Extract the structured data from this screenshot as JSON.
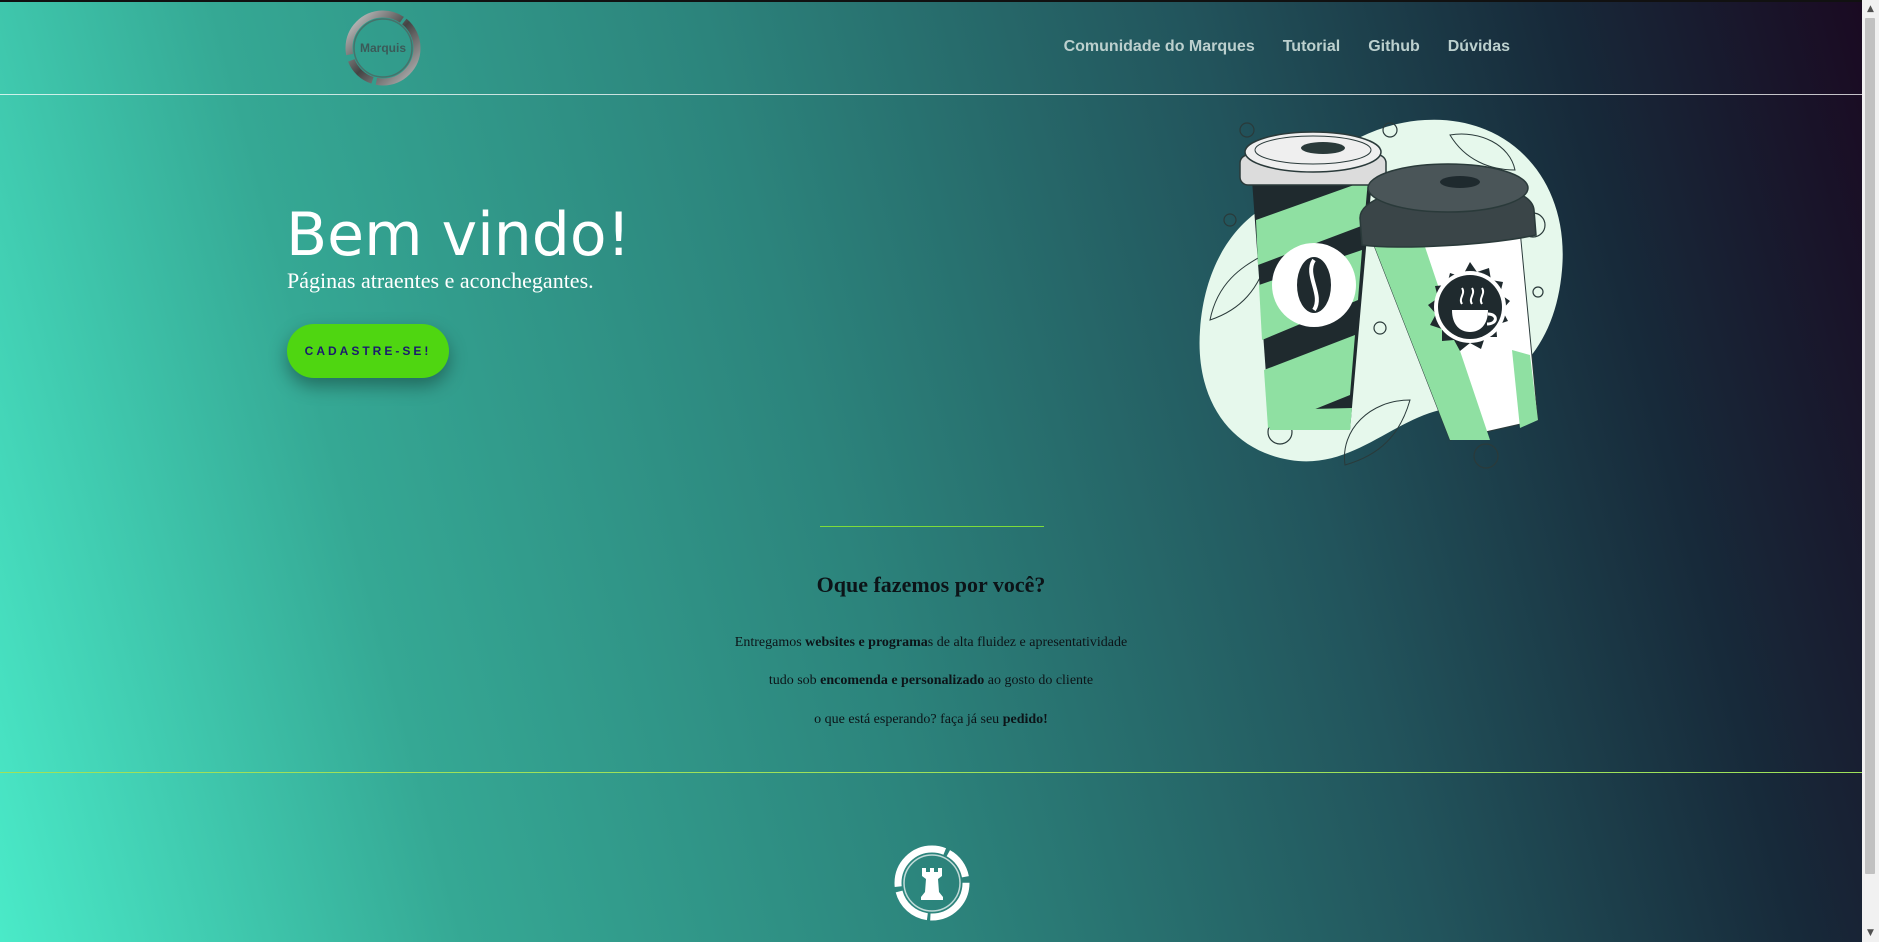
{
  "header": {
    "logo_text": "Marquis",
    "nav": [
      "Comunidade do Marques",
      "Tutorial",
      "Github",
      "Dúvidas"
    ]
  },
  "hero": {
    "title": "Bem vindo!",
    "subtitle": "Páginas atraentes e aconchegantes.",
    "cta_label": "CADASTRE-SE!"
  },
  "section": {
    "title": "Oque fazemos por você?",
    "lines": [
      [
        {
          "text": "Entregamos ",
          "bold": false
        },
        {
          "text": "websites e programa",
          "bold": true
        },
        {
          "text": "s de alta fluidez e apresentatividade",
          "bold": false
        }
      ],
      [
        {
          "text": "tudo sob ",
          "bold": false
        },
        {
          "text": "encomenda e personalizado",
          "bold": true
        },
        {
          "text": " ao gosto do cliente",
          "bold": false
        }
      ],
      [
        {
          "text": "o que está esperando? faça já seu ",
          "bold": false
        },
        {
          "text": "pedido!",
          "bold": true
        }
      ]
    ]
  },
  "colors": {
    "accent_green": "#4fd611",
    "cta_text": "#1a1a6e",
    "divider": "#7ddc3a",
    "cup_green": "#8fe0a2",
    "cup_dark": "#1f2a2e"
  },
  "icons": [
    "marquis-logo",
    "coffee-cups-illustration",
    "coffee-bean-icon",
    "coffee-cup-badge-icon",
    "chess-rook-logo-icon"
  ]
}
